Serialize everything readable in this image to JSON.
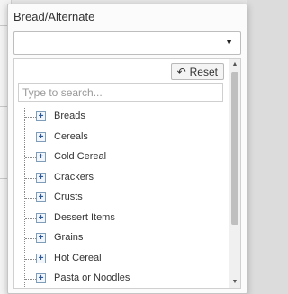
{
  "panel": {
    "title": "Bread/Alternate",
    "selected_value": "",
    "caret": "▼"
  },
  "toolbar": {
    "reset_icon": "undo-icon",
    "reset_glyph": "↶",
    "reset_label": "Reset"
  },
  "search": {
    "placeholder": "Type to search..."
  },
  "tree": {
    "expander_glyph": "+",
    "items": [
      {
        "label": "Breads"
      },
      {
        "label": "Cereals"
      },
      {
        "label": "Cold Cereal"
      },
      {
        "label": "Crackers"
      },
      {
        "label": "Crusts"
      },
      {
        "label": "Dessert Items"
      },
      {
        "label": "Grains"
      },
      {
        "label": "Hot Cereal"
      },
      {
        "label": "Pasta or Noodles"
      }
    ]
  },
  "scrollbar": {
    "up_glyph": "▲",
    "down_glyph": "▼"
  },
  "colors": {
    "expander_border": "#7f9db9",
    "expander_glyph": "#2c5aa0",
    "scroll_thumb": "#bfbfbf"
  }
}
